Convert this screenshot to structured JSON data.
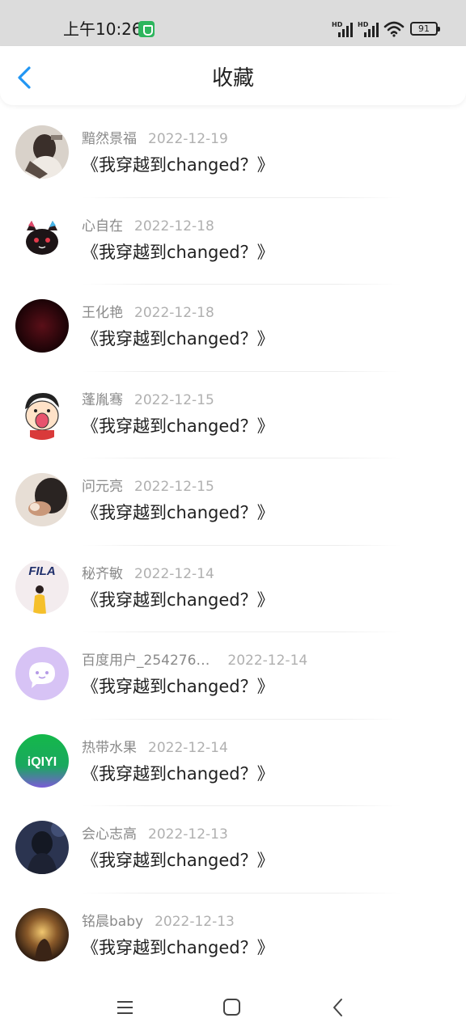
{
  "status_bar": {
    "time": "上午10:26",
    "signal_1_label": "HD",
    "signal_2_label": "HD",
    "battery": "91"
  },
  "header": {
    "title": "收藏",
    "back_icon": "chevron-left-icon",
    "accent_color": "#2196f3"
  },
  "favorites": [
    {
      "user": "黯然景福",
      "date": "2022-12-19",
      "title": "《我穿越到changed？》"
    },
    {
      "user": "心自在",
      "date": "2022-12-18",
      "title": "《我穿越到changed？》"
    },
    {
      "user": "王化艳",
      "date": "2022-12-18",
      "title": "《我穿越到changed？》"
    },
    {
      "user": "蓬胤骞",
      "date": "2022-12-15",
      "title": "《我穿越到changed？》"
    },
    {
      "user": "问元亮",
      "date": "2022-12-15",
      "title": "《我穿越到changed？》"
    },
    {
      "user": "秘齐敏",
      "date": "2022-12-14",
      "title": "《我穿越到changed？》"
    },
    {
      "user": "百度用户_254276…",
      "date": "2022-12-14",
      "title": "《我穿越到changed？》"
    },
    {
      "user": "热带水果",
      "date": "2022-12-14",
      "title": "《我穿越到changed？》"
    },
    {
      "user": "会心志高",
      "date": "2022-12-13",
      "title": "《我穿越到changed？》"
    },
    {
      "user": "铭晨baby",
      "date": "2022-12-13",
      "title": "《我穿越到changed？》"
    }
  ],
  "avatar_logos": {
    "fila": "FILA",
    "iqiyi": "iQIYI"
  },
  "nav_bar": {
    "menu_icon": "menu-icon",
    "home_icon": "home-icon",
    "back_icon": "back-triangle-icon"
  }
}
